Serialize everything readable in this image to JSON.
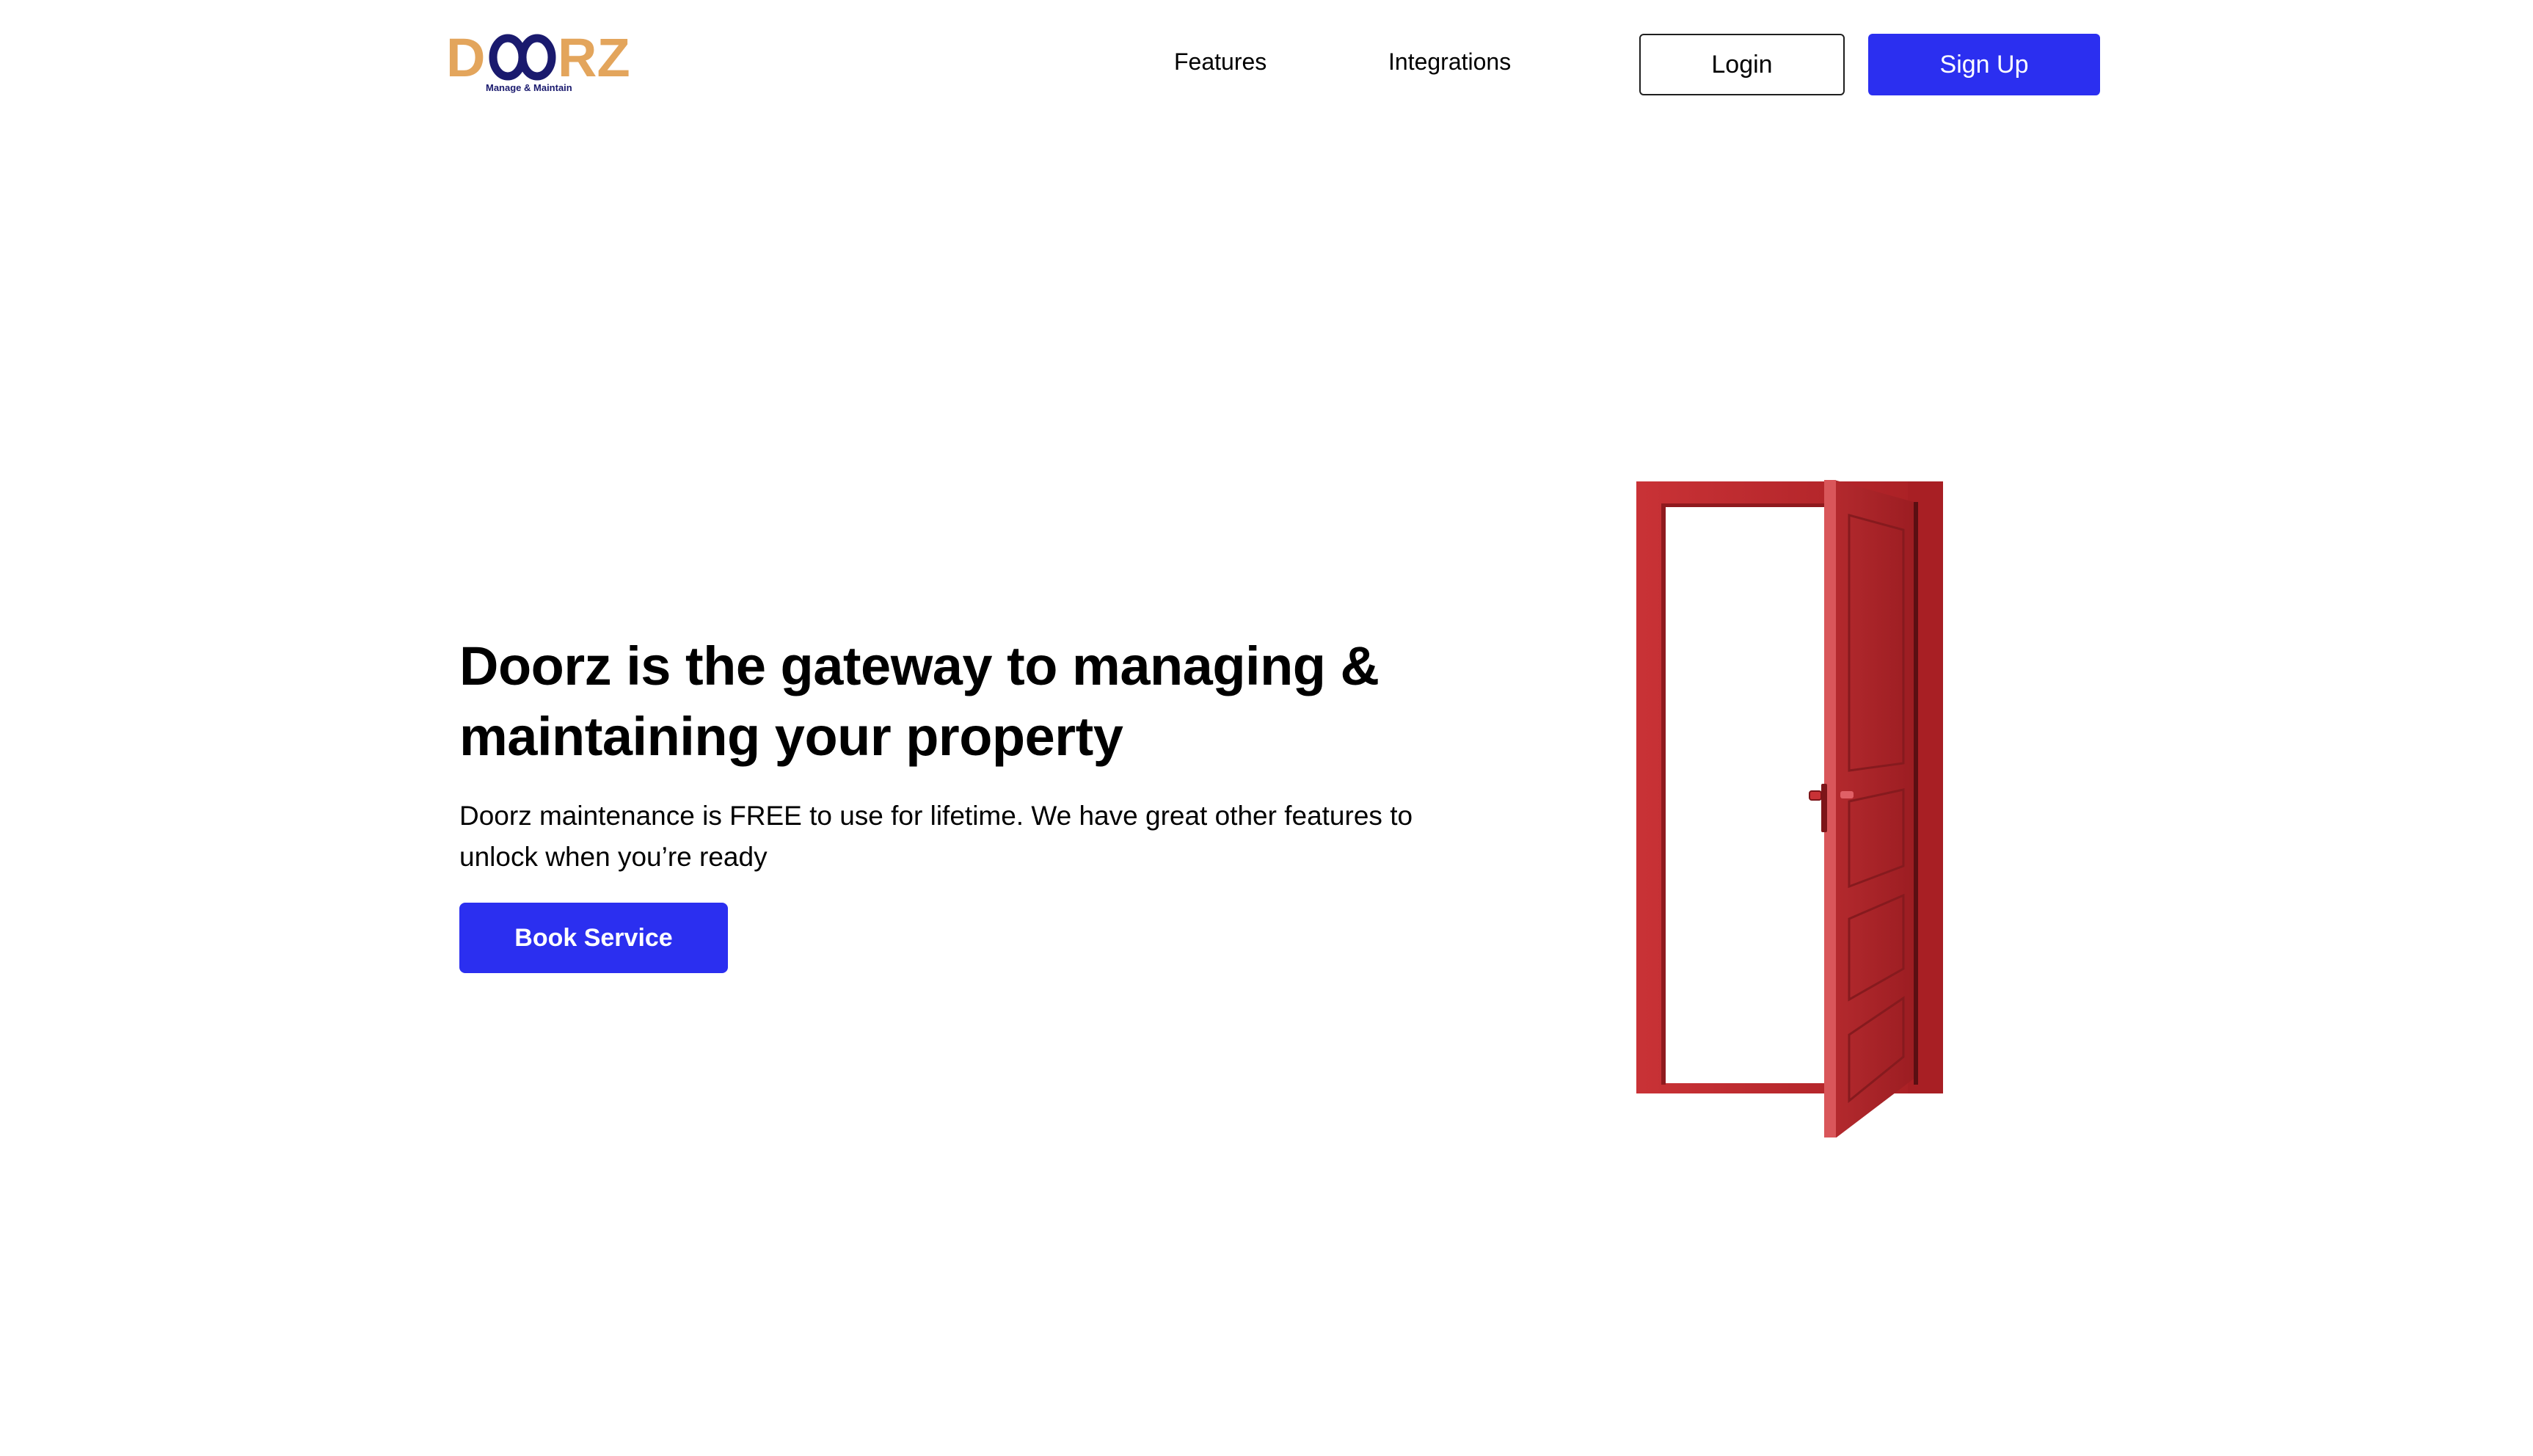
{
  "header": {
    "logo": {
      "text": "DOORZ",
      "tagline": "Manage & Maintain"
    },
    "nav": [
      {
        "label": "Features"
      },
      {
        "label": "Integrations"
      }
    ],
    "login_label": "Login",
    "signup_label": "Sign Up"
  },
  "hero": {
    "title": "Doorz is the gateway to managing & maintaining your property",
    "subtitle": "Doorz maintenance is FREE to use for lifetime. We have great other features to unlock when you’re ready",
    "cta_label": "Book Service",
    "illustration": "open-red-door"
  },
  "colors": {
    "brand_orange": "#e3a55c",
    "brand_navy": "#1a1a6e",
    "primary_blue": "#2b2ff0",
    "door_red": "#b8262a"
  }
}
